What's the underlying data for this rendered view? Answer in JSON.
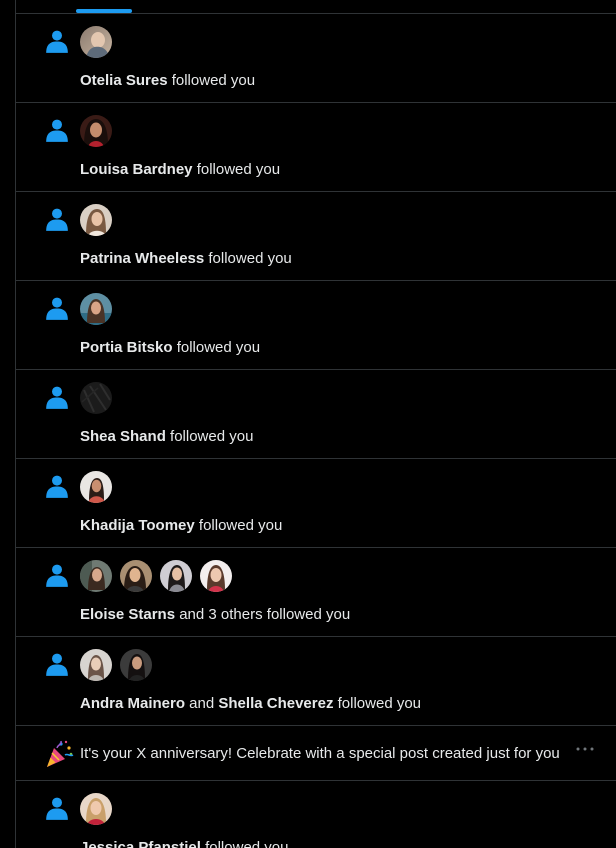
{
  "colors": {
    "accent": "#1d9bf0",
    "background": "#000000",
    "divider": "#2f3336",
    "text": "#e7e9ea"
  },
  "notifications": [
    {
      "icon": "person-icon",
      "avatars": 1,
      "name1": "Otelia Sures",
      "connector": "",
      "name2": "",
      "action": " followed you"
    },
    {
      "icon": "person-icon",
      "avatars": 1,
      "name1": "Louisa Bardney",
      "connector": "",
      "name2": "",
      "action": " followed you"
    },
    {
      "icon": "person-icon",
      "avatars": 1,
      "name1": "Patrina Wheeless",
      "connector": "",
      "name2": "",
      "action": " followed you"
    },
    {
      "icon": "person-icon",
      "avatars": 1,
      "name1": "Portia Bitsko",
      "connector": "",
      "name2": "",
      "action": " followed you"
    },
    {
      "icon": "person-icon",
      "avatars": 1,
      "name1": "Shea Shand",
      "connector": "",
      "name2": "",
      "action": " followed you"
    },
    {
      "icon": "person-icon",
      "avatars": 1,
      "name1": "Khadija Toomey",
      "connector": "",
      "name2": "",
      "action": " followed you"
    },
    {
      "icon": "person-icon",
      "avatars": 4,
      "name1": "Eloise Starns",
      "connector": "",
      "name2": "",
      "action": " and 3 others followed you"
    },
    {
      "icon": "person-icon",
      "avatars": 2,
      "name1": "Andra Mainero",
      "connector": " and ",
      "name2": "Shella Cheverez",
      "action": " followed you"
    },
    {
      "icon": "party-popper-icon",
      "text": "It's your X anniversary! Celebrate with a special post created just for you",
      "more": "more-icon"
    },
    {
      "icon": "person-icon",
      "avatars": 1,
      "name1": "Jessica Pfanstiel",
      "connector": "",
      "name2": "",
      "action": " followed you"
    }
  ]
}
